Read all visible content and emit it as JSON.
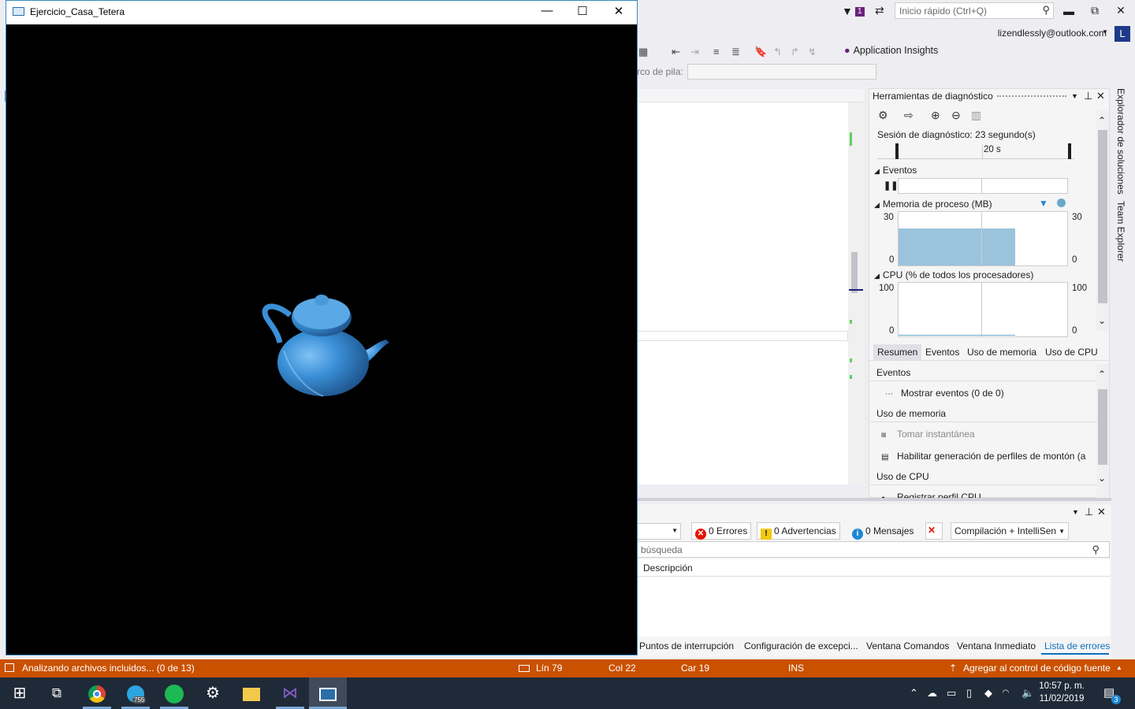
{
  "vs": {
    "quick_launch_placeholder": "Inicio rápido (Ctrl+Q)",
    "notification_count": "1",
    "account": "lizendlessly@outlook.com",
    "account_initial": "L",
    "app_insights": "Application Insights",
    "stack_frame_label": "rco de pila:",
    "minimize": "▬",
    "maximize": "⧉",
    "close": "✕"
  },
  "diag": {
    "title": "Herramientas de diagnóstico",
    "session": "Sesión de diagnóstico: 23 segundo(s)",
    "timeline_label": "20 s",
    "events_title": "Eventos",
    "memory_title": "Memoria de proceso (MB)",
    "memory_axis_max": "30",
    "memory_axis_min": "0",
    "cpu_title": "CPU (% de todos los procesadores)",
    "cpu_axis_max": "100",
    "cpu_axis_min": "0",
    "tabs": [
      "Resumen",
      "Eventos",
      "Uso de memoria",
      "Uso de CPU"
    ],
    "summary": {
      "events_hdr": "Eventos",
      "show_events": "Mostrar eventos (0 de 0)",
      "memory_hdr": "Uso de memoria",
      "snapshot": "Tomar instantánea",
      "heap_profiling": "Habilitar generación de perfiles de montón (a",
      "cpu_hdr": "Uso de CPU",
      "cpu_profile": "Registrar perfil CPU"
    }
  },
  "side_tabs": {
    "solution_explorer": "Explorador de soluciones",
    "team_explorer": "Team Explorer"
  },
  "errors": {
    "errors_btn": "0 Errores",
    "warnings_btn": "0 Advertencias",
    "messages_btn": "0 Mensajes",
    "build_select": "Compilación + IntelliSen",
    "search_placeholder": "búsqueda",
    "description_header": "Descripción",
    "bottom_tabs": [
      "Puntos de interrupción",
      "Configuración de excepci...",
      "Ventana Comandos",
      "Ventana Inmediato",
      "Lista de errores"
    ]
  },
  "status": {
    "analyzing": "Analizando archivos incluidos... (0 de 13)",
    "line": "Lín 79",
    "col": "Col 22",
    "char": "Car 19",
    "ins": "INS",
    "source_control": "Agregar al control de código fuente"
  },
  "taskbar": {
    "time": "10:57 p. m.",
    "date": "11/02/2019",
    "telegram_badge": "755",
    "notifications": "3"
  },
  "app": {
    "title": "Ejercicio_Casa_Tetera",
    "teapot_color": "#3a8fd6"
  },
  "memory_series": {
    "type": "area",
    "ylim": [
      0,
      30
    ],
    "fill_fraction": 0.69
  }
}
